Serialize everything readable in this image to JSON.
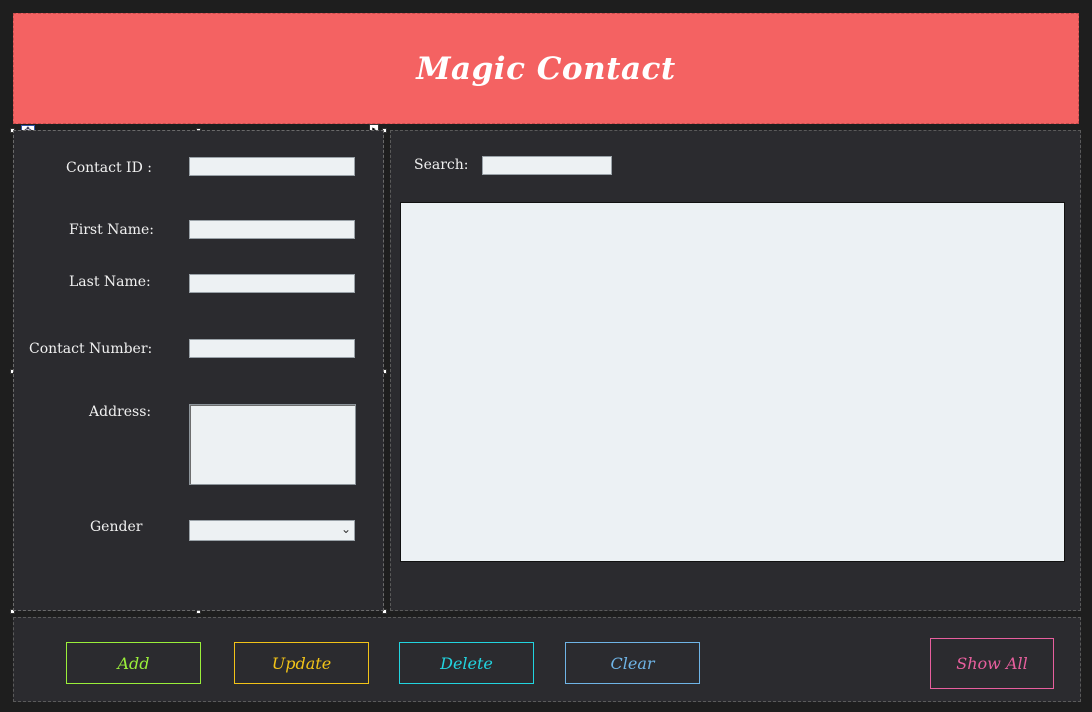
{
  "header": {
    "title": "Magic Contact"
  },
  "form": {
    "contact_id_label": "Contact ID :",
    "contact_id_value": "",
    "first_name_label": "First Name:",
    "first_name_value": "",
    "last_name_label": "Last Name:",
    "last_name_value": "",
    "contact_number_label": "Contact Number:",
    "contact_number_value": "",
    "address_label": "Address:",
    "address_value": "",
    "gender_label": "Gender",
    "gender_value": "",
    "gender_icon": "chevron-down-icon"
  },
  "search": {
    "label": "Search:",
    "value": ""
  },
  "buttons": {
    "add": {
      "label": "Add",
      "color": "#9aef3a"
    },
    "update": {
      "label": "Update",
      "color": "#f2c318"
    },
    "delete": {
      "label": "Delete",
      "color": "#22d4e0"
    },
    "clear": {
      "label": "Clear",
      "color": "#6fb4e6"
    },
    "show_all": {
      "label": "Show All",
      "color": "#e85f9e"
    }
  },
  "colors": {
    "header_bg": "#f46262",
    "panel_bg": "#2b2b2f",
    "window_bg": "#1e1e1e",
    "input_bg": "#edf1f3"
  }
}
